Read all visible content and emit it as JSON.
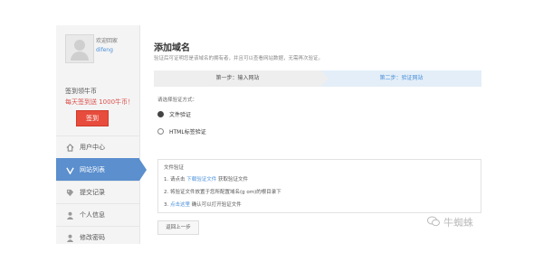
{
  "user": {
    "welcome": "欢迎回家",
    "username": "difeng"
  },
  "sign": {
    "title": "签到领牛币",
    "note": "每天签到送 1000牛币！",
    "button": "签到"
  },
  "sidebar": {
    "items": [
      {
        "label": "用户中心",
        "icon": "home-icon"
      },
      {
        "label": "网站列表",
        "icon": "v-icon"
      },
      {
        "label": "提交记录",
        "icon": "tag-icon"
      },
      {
        "label": "个人信息",
        "icon": "user-icon"
      },
      {
        "label": "修改密码",
        "icon": "user-icon"
      }
    ],
    "active_index": 1
  },
  "main": {
    "title": "添加域名",
    "description": "验证后可证明您是该域名的拥有者，并且可以查看网站数据，无需再次验证。",
    "steps": [
      "第一步：输入网站",
      "第二步：验证网站"
    ],
    "method_label": "请选择验证方式：",
    "methods": [
      {
        "label": "文件验证",
        "checked": true
      },
      {
        "label": "HTML标签验证",
        "checked": false
      }
    ],
    "file_box": {
      "title": "文件验证",
      "line1_prefix": "1. 请点击",
      "line1_link": "下载验证文件",
      "line1_suffix": "获取验证文件",
      "line2": "2. 将验证文件放置于您所配置域名(g              om)的根目录下",
      "line3_prefix": "3.",
      "line3_link": "点击这里",
      "line3_suffix": "确认可以打开验证文件"
    },
    "prev_button": "返回上一步"
  },
  "watermark": "牛蜘蛛",
  "colors": {
    "accent": "#4a90d9",
    "active_nav": "#5b8fce",
    "sign_button": "#e74c3c"
  }
}
